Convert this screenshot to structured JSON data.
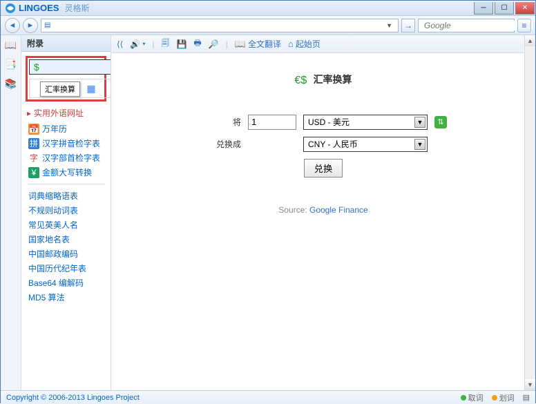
{
  "titlebar": {
    "brand": "LINGOES",
    "brand_cn": "灵格斯"
  },
  "topbar": {
    "search_placeholder": "Google"
  },
  "sidebar": {
    "title": "附录",
    "tooltip": "汇率换算",
    "section1": "实用外语网址",
    "items1": [
      {
        "icon": "📅",
        "label": "万年历",
        "bg": "#f09030"
      },
      {
        "icon": "拼",
        "label": "汉字拼音检字表",
        "bg": "#3080e0",
        "fg": "#fff"
      },
      {
        "icon": "字",
        "label": "汉字部首检字表",
        "bg": "",
        "fg": "#d04040"
      },
      {
        "icon": "¥",
        "label": "金额大写转换",
        "bg": "#20a060",
        "fg": "#fff"
      }
    ],
    "items2": [
      "词典缩略语表",
      "不规则动词表",
      "常见英美人名",
      "国家地名表",
      "中国邮政编码",
      "中国历代纪年表",
      "Base64 编解码",
      "MD5 算法"
    ]
  },
  "main_toolbar": {
    "fulltrans": "全文翻译",
    "home": "起始页"
  },
  "converter": {
    "title": "汇率换算",
    "label_from": "将",
    "label_to": "兑换成",
    "amount": "1",
    "currency_from": "USD - 美元",
    "currency_to": "CNY - 人民币",
    "convert_btn": "兑换",
    "source_prefix": "Source: ",
    "source_link": "Google Finance"
  },
  "statusbar": {
    "copyright": "Copyright © 2006-2013 Lingoes Project",
    "pick": "取词",
    "scribe": "划词"
  }
}
